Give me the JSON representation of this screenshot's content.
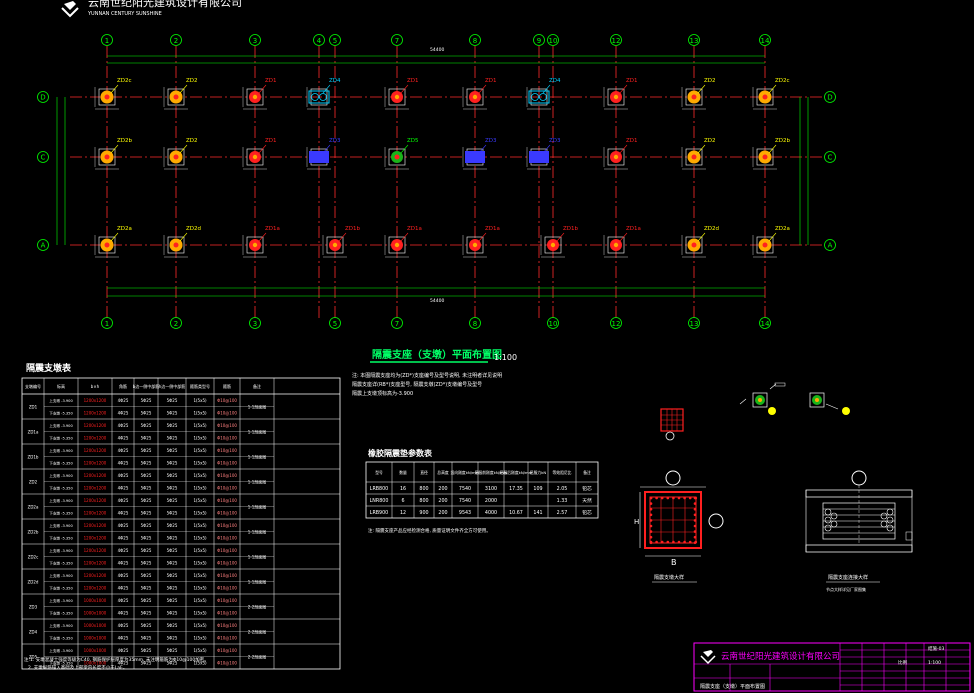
{
  "company": {
    "name_top": "云南世纪阳光建筑设计有限公司",
    "name_en": "YUNNAN CENTURY SUNSHINE",
    "name_bottom": "云南世纪阳光建筑设计有限公司"
  },
  "grid": {
    "columns": [
      "1",
      "2",
      "3",
      "4",
      "5",
      "7",
      "8",
      "9",
      "10",
      "12",
      "13",
      "14"
    ],
    "bottom_columns": [
      "1",
      "2",
      "3",
      "5",
      "7",
      "8",
      "10",
      "12",
      "13",
      "14"
    ],
    "rows": [
      "D",
      "C",
      "A"
    ],
    "overall_dim": "54400"
  },
  "plan": {
    "title": "隔震支座（支墩）平面布置图",
    "scale": "1:100",
    "notes": [
      "注: 本图隔震支座均为(ZD*)支座编号及型号说明, 未注明者详见说明",
      "隔震支座详(RB*)支座型号, 隔震支墩(ZD*)支墩编号及型号",
      "隔震上支墩顶标高为-3.900"
    ]
  },
  "labels": {
    "row_D": [
      "ZD2c",
      "ZD2",
      "ZD1",
      "ZD4",
      "ZD1",
      "ZD1",
      "ZD4",
      "ZD1",
      "ZD2",
      "ZD2c"
    ],
    "row_C": [
      "ZD2b",
      "ZD2",
      "ZD1",
      "ZD3",
      "ZD5",
      "ZD3",
      "ZD3",
      "ZD1",
      "ZD2",
      "ZD2b"
    ],
    "row_A": [
      "ZD2a",
      "ZD2d",
      "ZD1a",
      "ZD1b",
      "ZD1a",
      "ZD1a",
      "ZD1b",
      "ZD1a",
      "ZD2d",
      "ZD2a"
    ]
  },
  "pier_table": {
    "title": "隔震支墩表",
    "headers": [
      "支墩编号",
      "标高",
      "b×h",
      "角筋",
      "b边一侧中部筋",
      "h边一侧中部筋",
      "箍筋类型号",
      "箍筋",
      "备注"
    ],
    "rows": [
      [
        "ZD1",
        "上支墩 -3.900",
        "1200x1200",
        "4Φ25",
        "5Φ25",
        "5Φ25",
        "1(5x5)",
        "Φ10@100",
        "1-1剖面图"
      ],
      [
        "",
        "下支墩 -5.350",
        "1200x1200",
        "4Φ25",
        "5Φ25",
        "5Φ25",
        "1(5x5)",
        "Φ10@100",
        ""
      ],
      [
        "ZD1a",
        "上支墩 -3.900",
        "1200x1200",
        "4Φ25",
        "5Φ25",
        "5Φ25",
        "1(5x5)",
        "Φ10@100",
        "1-1剖面图"
      ],
      [
        "",
        "下支墩 -5.350",
        "1200x1200",
        "4Φ25",
        "5Φ25",
        "5Φ25",
        "1(5x5)",
        "Φ10@100",
        ""
      ],
      [
        "ZD1b",
        "上支墩 -3.900",
        "1200x1200",
        "4Φ25",
        "5Φ25",
        "5Φ25",
        "1(5x5)",
        "Φ10@100",
        "1-1剖面图"
      ],
      [
        "",
        "下支墩 -5.350",
        "1200x1200",
        "4Φ25",
        "5Φ25",
        "5Φ25",
        "1(5x5)",
        "Φ10@100",
        ""
      ],
      [
        "ZD2",
        "上支墩 -3.900",
        "1200x1200",
        "4Φ25",
        "5Φ25",
        "5Φ25",
        "1(5x5)",
        "Φ10@100",
        "1-1剖面图"
      ],
      [
        "",
        "下支墩 -5.350",
        "1200x1200",
        "4Φ25",
        "5Φ25",
        "5Φ25",
        "1(5x5)",
        "Φ10@100",
        ""
      ],
      [
        "ZD2a",
        "上支墩 -3.900",
        "1200x1200",
        "4Φ25",
        "5Φ25",
        "5Φ25",
        "1(5x5)",
        "Φ10@100",
        "1-1剖面图"
      ],
      [
        "",
        "下支墩 -5.350",
        "1200x1200",
        "4Φ25",
        "5Φ25",
        "5Φ25",
        "1(5x5)",
        "Φ10@100",
        ""
      ],
      [
        "ZD2b",
        "上支墩 -3.900",
        "1200x1200",
        "4Φ25",
        "5Φ25",
        "5Φ25",
        "1(5x5)",
        "Φ10@100",
        "1-1剖面图"
      ],
      [
        "",
        "下支墩 -5.350",
        "1200x1200",
        "4Φ25",
        "5Φ25",
        "5Φ25",
        "1(5x5)",
        "Φ10@100",
        ""
      ],
      [
        "ZD2c",
        "上支墩 -3.900",
        "1200x1200",
        "4Φ25",
        "5Φ25",
        "5Φ25",
        "1(5x5)",
        "Φ10@100",
        "1-1剖面图"
      ],
      [
        "",
        "下支墩 -5.350",
        "1200x1200",
        "4Φ25",
        "5Φ25",
        "5Φ25",
        "1(5x5)",
        "Φ10@100",
        ""
      ],
      [
        "ZD2d",
        "上支墩 -3.900",
        "1200x1200",
        "4Φ25",
        "5Φ25",
        "5Φ25",
        "1(5x5)",
        "Φ10@100",
        "1-1剖面图"
      ],
      [
        "",
        "下支墩 -5.350",
        "1200x1200",
        "4Φ25",
        "5Φ25",
        "5Φ25",
        "1(5x5)",
        "Φ10@100",
        ""
      ],
      [
        "ZD3",
        "上支墩 -3.900",
        "1000x1000",
        "4Φ25",
        "5Φ25",
        "5Φ25",
        "1(5x5)",
        "Φ10@100",
        "2-2剖面图"
      ],
      [
        "",
        "下支墩 -5.350",
        "1000x1000",
        "4Φ25",
        "5Φ25",
        "5Φ25",
        "1(5x5)",
        "Φ10@100",
        ""
      ],
      [
        "ZD4",
        "上支墩 -3.900",
        "1000x1000",
        "4Φ25",
        "5Φ25",
        "5Φ25",
        "1(5x5)",
        "Φ10@100",
        "2-2剖面图"
      ],
      [
        "",
        "下支墩 -5.350",
        "1000x1000",
        "4Φ25",
        "5Φ25",
        "5Φ25",
        "1(5x5)",
        "Φ10@100",
        ""
      ],
      [
        "ZD5",
        "上支墩 -3.900",
        "1000x1000",
        "4Φ25",
        "5Φ25",
        "5Φ25",
        "1(5x5)",
        "Φ10@100",
        "2-2剖面图"
      ],
      [
        "",
        "下支墩 -5.350",
        "1000x1000",
        "4Φ25",
        "5Φ25",
        "5Φ25",
        "1(5x5)",
        "Φ10@100",
        ""
      ]
    ],
    "notes": [
      "注:1. 支墩混凝土强度等级为C40, 钢筋保护层厚度为35mm, 未注明箍筋为Φ10@100加密。",
      "2. 支墩纵筋锚入基础及上部梁内长度不小于LaE。"
    ]
  },
  "bearing_table": {
    "title": "橡胶隔震垫参数表",
    "headers": [
      "型号",
      "数量",
      "直径",
      "总高度",
      "竖向刚度kN/mm",
      "屈服前刚度kN/mm",
      "屈服后刚度kN/mm",
      "屈服力kN",
      "等效阻尼比",
      "备注"
    ],
    "rows": [
      [
        "LRB800",
        "16",
        "800",
        "200",
        "7540",
        "3100",
        "17.35",
        "109",
        "2.05",
        "铅芯"
      ],
      [
        "LNR800",
        "6",
        "800",
        "200",
        "7540",
        "2000",
        "",
        "",
        "1.33",
        "天然"
      ],
      [
        "LRB900",
        "12",
        "900",
        "200",
        "9543",
        "4000",
        "10.67",
        "141",
        "2.57",
        "铅芯"
      ]
    ],
    "note": "注: 隔震支座产品应经检测合格, 质量证明文件齐全方可使用。"
  },
  "details": {
    "section_caption": "隔震支墩大样",
    "connection_caption": "隔震支座连接大样",
    "connection_sub": "节点大样详见厂家图集",
    "dim_b": "B",
    "dim_h": "H"
  },
  "title_block": {
    "project": "隔震支座（支墩）平面布置图",
    "drawing_no": "结施-03",
    "scale_label": "比例",
    "scale_value": "1:100"
  },
  "colors": {
    "background": "#000000",
    "axis": "#ff2b2b",
    "dim": "#00ff00",
    "text": "#ffffff",
    "title": "#00ff66",
    "frame": "#ff00ff",
    "pier_orange": "#ffaa00",
    "pier_red": "#ff2020",
    "pier_green": "#19b419",
    "pier_blue": "#3a3aff",
    "pier_cyan": "#00d0ff"
  }
}
